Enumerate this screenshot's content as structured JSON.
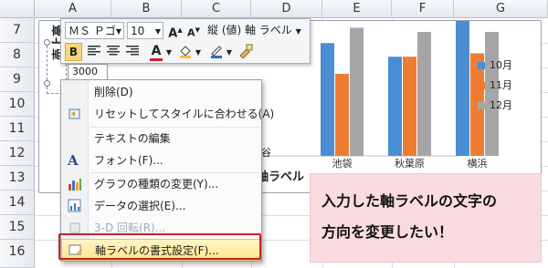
{
  "sheet": {
    "columns": [
      "A",
      "B",
      "C",
      "D",
      "E",
      "F",
      "G"
    ],
    "rows": [
      "7",
      "8",
      "9",
      "10",
      "11",
      "12",
      "13",
      "14",
      "15",
      "16"
    ]
  },
  "chart": {
    "axis_title_vertical": "売上高",
    "x_axis_title": "軸ラベル",
    "value_label": "3000",
    "categories": [
      "池袋",
      "秋葉原",
      "横浜"
    ],
    "partial_category": "谷",
    "legend": [
      "10月",
      "11月",
      "12月"
    ]
  },
  "chart_data": {
    "type": "bar",
    "categories": [
      "",
      "",
      "",
      "池袋",
      "秋葉原",
      "横浜"
    ],
    "series": [
      {
        "name": "10月",
        "values": [
          null,
          null,
          null,
          132,
          116,
          160
        ]
      },
      {
        "name": "11月",
        "values": [
          null,
          null,
          null,
          96,
          116,
          120
        ]
      },
      {
        "name": "12月",
        "values": [
          null,
          null,
          null,
          150,
          145,
          145
        ]
      }
    ],
    "colors": [
      "#4a8fd4",
      "#ee7d33",
      "#a6a6a6"
    ],
    "legend_position": "right"
  },
  "toolbar": {
    "font_name": "ＭＳ Ｐゴ",
    "font_size": "10",
    "grow_font": "A",
    "shrink_font": "A",
    "vertical_text": "縦 (値) 軸 ラベル",
    "bold": "B",
    "font_color": "A"
  },
  "context_menu": {
    "items": [
      {
        "label": "削除(D)",
        "disabled": false
      },
      {
        "label": "リセットしてスタイルに合わせる(A)",
        "disabled": false
      },
      {
        "label": "テキストの編集",
        "disabled": false
      },
      {
        "label": "フォント(F)...",
        "disabled": false
      },
      {
        "label": "グラフの種類の変更(Y)...",
        "disabled": false
      },
      {
        "label": "データの選択(E)...",
        "disabled": false
      },
      {
        "label": "3-D 回転(R)...",
        "disabled": true
      },
      {
        "label": "軸ラベルの書式設定(F)...",
        "disabled": false
      }
    ]
  },
  "callout": {
    "line1": "入力した軸ラベルの文字の",
    "line2": "方向を変更したい！"
  },
  "colors": {
    "accent_highlight": "#c8222a",
    "callout_bg": "#f9dbe0",
    "menu_highlight": "#ffe58a"
  }
}
